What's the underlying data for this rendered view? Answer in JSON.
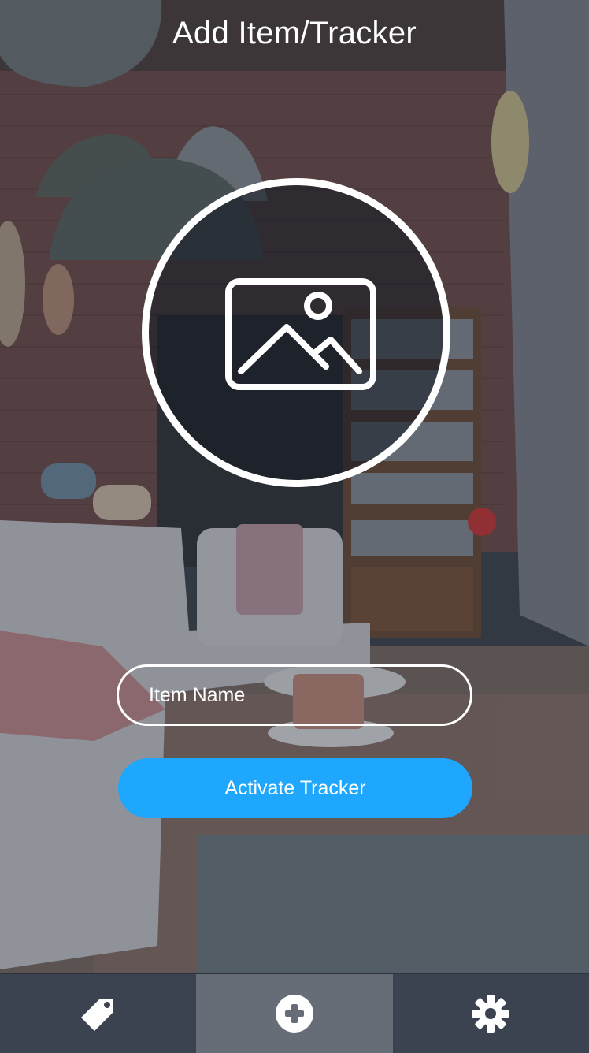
{
  "header": {
    "title": "Add Item/Tracker"
  },
  "photo_picker": {
    "icon": "image-icon"
  },
  "form": {
    "item_name_placeholder": "Item Name",
    "item_name_value": "",
    "activate_label": "Activate Tracker"
  },
  "tabbar": {
    "tabs": [
      {
        "icon": "tag-icon",
        "active": false
      },
      {
        "icon": "add-circle-icon",
        "active": true
      },
      {
        "icon": "gear-icon",
        "active": false
      }
    ]
  },
  "colors": {
    "accent": "#1ea7fd",
    "tabbar_bg": "#3b4250",
    "tab_active_bg": "#676d77",
    "text": "#ffffff"
  }
}
